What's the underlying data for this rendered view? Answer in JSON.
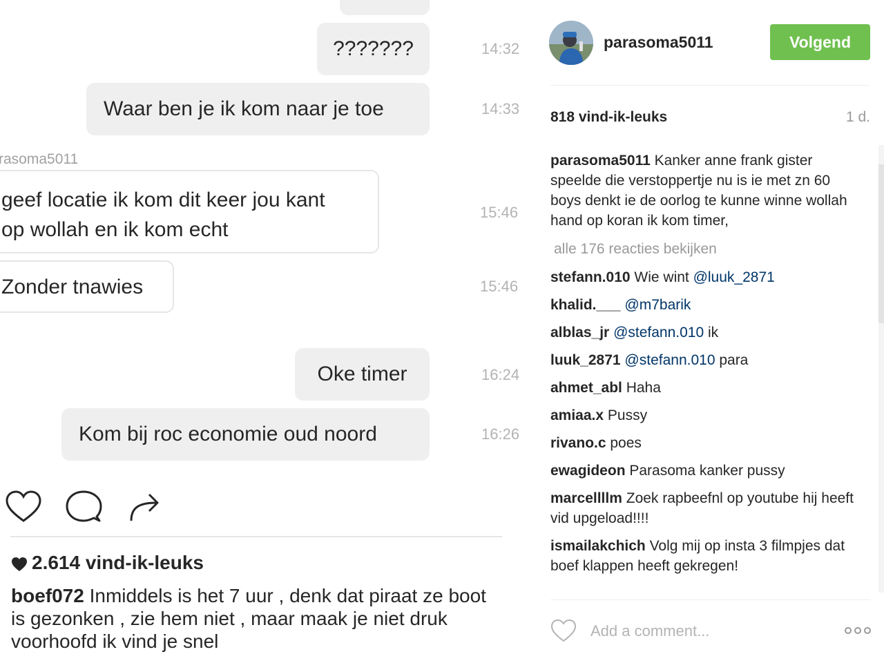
{
  "chat": {
    "messages": [
      {
        "text": "???????",
        "time": "14:32"
      },
      {
        "text": "Waar ben je ik kom naar je toe",
        "time": "14:33"
      },
      {
        "sender": "rasoma5011",
        "line1": "geef locatie ik kom dit keer jou kant",
        "line2": "op wollah en ik kom echt",
        "time": "15:46"
      },
      {
        "text": "Zonder tnawies",
        "time": "15:46"
      },
      {
        "text": "Oke timer",
        "time": "16:24"
      },
      {
        "text": "Kom bij roc economie oud noord",
        "time": "16:26"
      }
    ]
  },
  "post": {
    "likes": "2.614 vind-ik-leuks",
    "caption_user": "boef072",
    "caption_text": " Inmiddels is het 7 uur , denk dat piraat ze boot is gezonken , zie hem niet , maar maak je niet druk voorhoofd ik vind je snel",
    "icons": [
      "heart-icon",
      "comment-icon",
      "share-icon"
    ]
  },
  "sidebar": {
    "username": "parasoma5011",
    "follow_label": "Volgend",
    "follow_color": "#70c050",
    "likes": "818 vind-ik-leuks",
    "age": "1 d.",
    "caption_user": "parasoma5011",
    "caption_text": " Kanker anne frank gister speelde die verstoppertje nu is ie met zn 60 boys denkt ie de oorlog te kunne winne wollah hand op koran ik kom timer,",
    "view_all": "alle 176 reacties bekijken",
    "comments": [
      {
        "user": "stefann.010",
        "text": " Wie wint ",
        "mention": "@luuk_2871",
        "after": ""
      },
      {
        "user": "khalid.___",
        "text": " ",
        "mention": "@m7barik",
        "after": ""
      },
      {
        "user": "alblas_jr",
        "text": " ",
        "mention": "@stefann.010",
        "after": " ik"
      },
      {
        "user": "luuk_2871",
        "text": " ",
        "mention": "@stefann.010",
        "after": " para"
      },
      {
        "user": "ahmet_abl",
        "text": " Haha",
        "mention": "",
        "after": ""
      },
      {
        "user": "amiaa.x",
        "text": " Pussy",
        "mention": "",
        "after": ""
      },
      {
        "user": "rivano.c",
        "text": " poes",
        "mention": "",
        "after": ""
      },
      {
        "user": "ewagideon",
        "text": " Parasoma kanker pussy",
        "mention": "",
        "after": ""
      },
      {
        "user": "marcellllm",
        "text": " Zoek rapbeefnl op youtube hij heeft vid upgeload!!!!",
        "mention": "",
        "after": ""
      },
      {
        "user": "ismailakchich",
        "text": " Volg mij op insta 3 filmpjes dat boef klappen heeft gekregen!",
        "mention": "",
        "after": ""
      }
    ],
    "add_comment_placeholder": "Add a comment..."
  }
}
